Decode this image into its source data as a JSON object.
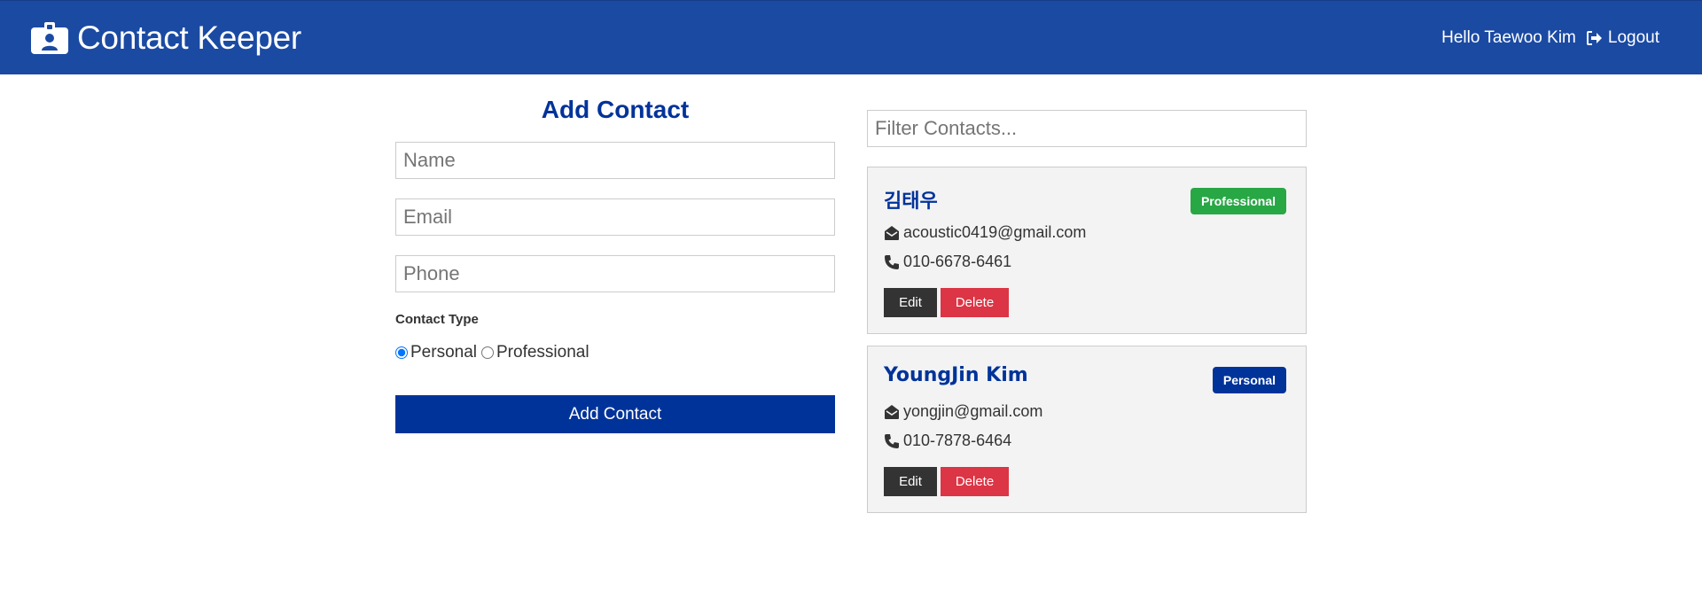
{
  "app": {
    "title": "Contact Keeper",
    "greeting": "Hello Taewoo Kim",
    "logout_label": "Logout",
    "brand_color": "#1b4aa3",
    "brand_icon": "id-badge-icon",
    "logout_icon": "sign-out-icon"
  },
  "form": {
    "title": "Add Contact",
    "name_placeholder": "Name",
    "email_placeholder": "Email",
    "phone_placeholder": "Phone",
    "type_label": "Contact Type",
    "options": [
      {
        "label": "Personal",
        "selected": true
      },
      {
        "label": "Professional",
        "selected": false
      }
    ],
    "submit_label": "Add Contact",
    "accent_color": "#003399"
  },
  "filter": {
    "placeholder": "Filter Contacts..."
  },
  "contacts": [
    {
      "name": "김태우",
      "type": "Professional",
      "type_color": "#28a745",
      "email": "acoustic0419@gmail.com",
      "phone": "010-6678-6461",
      "edit_label": "Edit",
      "delete_label": "Delete"
    },
    {
      "name": "YoungJin Kim",
      "type": "Personal",
      "type_color": "#003399",
      "email": "yongjin@gmail.com",
      "phone": "010-7878-6464",
      "edit_label": "Edit",
      "delete_label": "Delete"
    }
  ],
  "icons": {
    "email": "envelope-open-icon",
    "phone": "phone-icon"
  }
}
